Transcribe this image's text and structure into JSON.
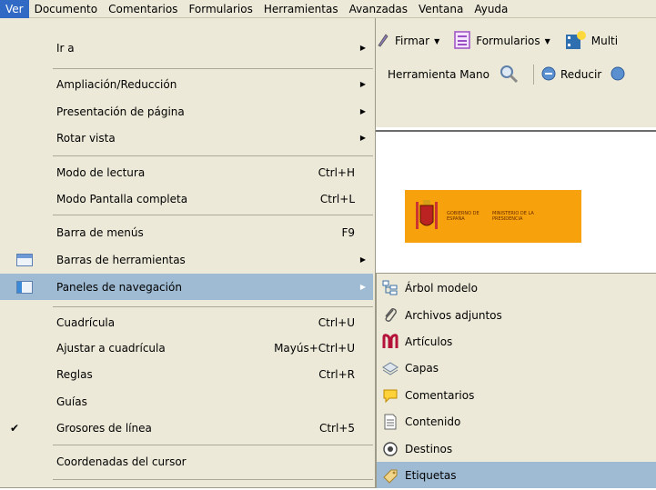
{
  "menubar": {
    "items": [
      "Ver",
      "Documento",
      "Comentarios",
      "Formularios",
      "Herramientas",
      "Avanzadas",
      "Ventana",
      "Ayuda"
    ]
  },
  "toolbar": {
    "firmar": "Firmar",
    "formularios": "Formularios",
    "multi": "Multi",
    "hand_tool": "Herramienta Mano",
    "reducir": "Reducir"
  },
  "banner": {
    "gobierno": "GOBIERNO DE ESPAÑA",
    "ministerio": "MINISTERIO DE LA PRESIDENCIA"
  },
  "ver_menu": {
    "items": [
      {
        "label": "Ir a",
        "shortcut": "",
        "submenu": true
      },
      {
        "label": "Ampliación/Reducción",
        "shortcut": "",
        "submenu": true
      },
      {
        "label": "Presentación de página",
        "shortcut": "",
        "submenu": true
      },
      {
        "label": "Rotar vista",
        "shortcut": "",
        "submenu": true
      },
      {
        "label": "Modo de lectura",
        "shortcut": "Ctrl+H",
        "submenu": false
      },
      {
        "label": "Modo Pantalla completa",
        "shortcut": "Ctrl+L",
        "submenu": false
      },
      {
        "label": "Barra de menús",
        "shortcut": "F9",
        "submenu": false
      },
      {
        "label": "Barras de herramientas",
        "shortcut": "",
        "submenu": true
      },
      {
        "label": "Paneles de navegación",
        "shortcut": "",
        "submenu": true
      },
      {
        "label": "Cuadrícula",
        "shortcut": "Ctrl+U",
        "submenu": false
      },
      {
        "label": "Ajustar a cuadrícula",
        "shortcut": "Mayús+Ctrl+U",
        "submenu": false
      },
      {
        "label": "Reglas",
        "shortcut": "Ctrl+R",
        "submenu": false
      },
      {
        "label": "Guías",
        "shortcut": "",
        "submenu": false
      },
      {
        "label": "Grosores de línea",
        "shortcut": "Ctrl+5",
        "submenu": false
      },
      {
        "label": "Coordenadas del cursor",
        "shortcut": "",
        "submenu": false
      }
    ]
  },
  "nav_submenu": {
    "items": [
      {
        "label": "Árbol modelo"
      },
      {
        "label": "Archivos adjuntos"
      },
      {
        "label": "Artículos"
      },
      {
        "label": "Capas"
      },
      {
        "label": "Comentarios"
      },
      {
        "label": "Contenido"
      },
      {
        "label": "Destinos"
      },
      {
        "label": "Etiquetas"
      }
    ]
  },
  "colors": {
    "menu_bg": "#ece9d8",
    "highlight": "#9fbbd3",
    "menubar_active": "#316ac5",
    "banner": "#f7a20c"
  }
}
